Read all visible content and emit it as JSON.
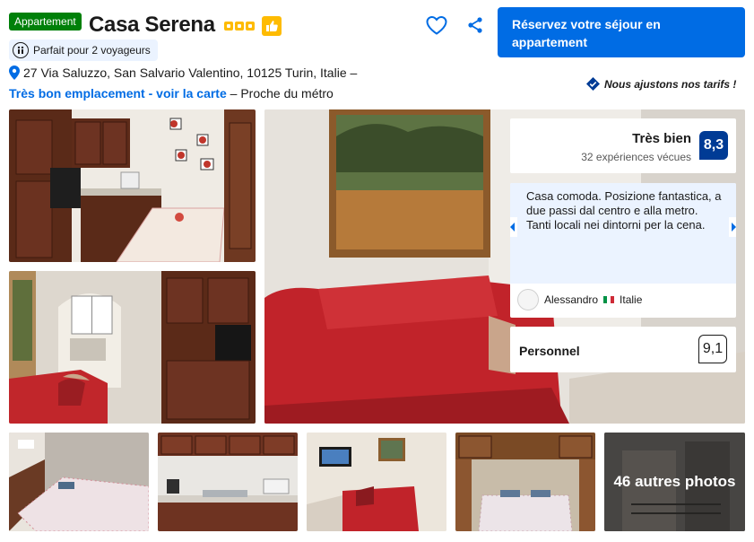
{
  "header": {
    "type_badge": "Appartement",
    "name": "Casa Serena",
    "star_count": 3,
    "travelers_label": "Parfait pour 2 voyageurs",
    "address": "27 Via Saluzzo, San Salvario Valentino, 10125 Turin, Italie –",
    "location_link": "Très bon emplacement - voir la carte",
    "location_suffix": " – Proche du métro",
    "reserve_label": "Réservez votre séjour en appartement",
    "price_promise": "Nous ajustons nos tarifs !"
  },
  "review": {
    "score_word": "Très bien",
    "score_count": "32 expériences vécues",
    "score": "8,3",
    "quote": "Casa comoda. Posizione fantastica, a due passi dal centro e alla metro. Tanti locali nei dintorni per la cena.",
    "reviewer_name": "Alessandro",
    "reviewer_country": "Italie",
    "staff_label": "Personnel",
    "staff_score": "9,1"
  },
  "gallery": {
    "more_photos": "46 autres photos"
  },
  "colors": {
    "primary": "#006ce4",
    "badge_green": "#008009",
    "score_blue": "#003b95",
    "star_yellow": "#febb02"
  }
}
